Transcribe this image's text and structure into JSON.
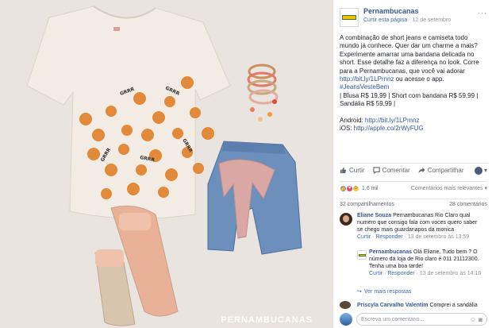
{
  "photo": {
    "watermark": "PERNAMBUCANAS",
    "shirt_print_text": "GRRR"
  },
  "post": {
    "page_name": "Pernambucanas",
    "like_page_label": "Curtir esta página",
    "separator": "·",
    "date": "12 de setembro",
    "more_label": "···",
    "body": {
      "line1": "A combinação de short jeans e camiseta todo mundo já conhece. Quer dar um charme a mais? Experimente amarrar uma bandana delicada no short. Esse detalhe faz a diferença no look. Corre para a Pernambucanas, que você vai adorar",
      "link1": "http://bit.ly/1LPrnnz",
      "line1b": " ou acesse o app.",
      "hashtag": "#JeansVesteBem",
      "prices": "| Blusa R$ 19,99 | Short com bandana R$ 59,99 | Sandália R$ 59,99 |",
      "android_label": "Android: ",
      "android_link": "http://bit.ly/1LPrnnz",
      "ios_label": "iOS: ",
      "ios_link": "http://apple.co/2rWyFUG"
    },
    "actions": {
      "like": "Curtir",
      "comment": "Comentar",
      "share": "Compartilhar"
    },
    "reactions": {
      "count": "1,6 mil",
      "sort_label": "Comentários mais relevantes"
    },
    "stats": {
      "shares": "32 compartilhamentos",
      "comments": "28 comentários"
    },
    "comments": [
      {
        "author": "Eliane Souza",
        "text": " Pernambucanas Rio Claro qual numero que consigo fala com voces quero saber se chego mais guardanapos da monica",
        "like": "Curtir",
        "reply": "Responder",
        "time": "13 de setembro às 13:59"
      },
      {
        "author": "Pernambucanas",
        "text": " Olá Eliane, Tudo bem ? O número da loja de Rio claro é 011 21112300. Tenha uma boa tarde!",
        "like": "Curtir",
        "reply": "Responder",
        "time": "13 de setembro às 14:16"
      },
      {
        "author": "Priscyla Carvalho Valentim",
        "text": " Comprei a sandália"
      }
    ],
    "more_replies": "Ver mais respostas",
    "composer": {
      "placeholder": "Escreva um comentário..."
    }
  },
  "colors": {
    "link": "#365899",
    "accent": "#4267b2",
    "muted": "#90949c",
    "brand_yellow": "#f2c200",
    "brand_green": "#3c7a2e"
  }
}
